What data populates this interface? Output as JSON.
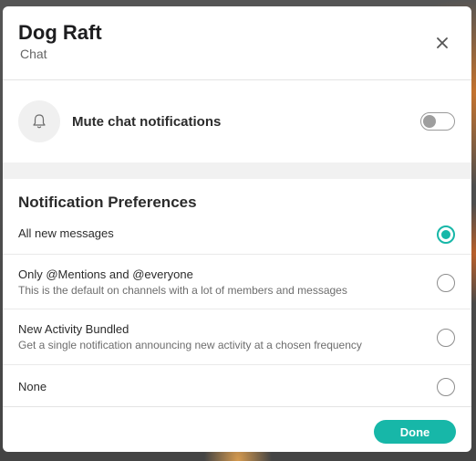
{
  "header": {
    "title": "Dog Raft",
    "subtitle": "Chat",
    "close_icon": "close-icon"
  },
  "mute": {
    "icon": "bell-icon",
    "label": "Mute chat notifications",
    "enabled": false
  },
  "preferences": {
    "title": "Notification Preferences",
    "selected": "all",
    "options": [
      {
        "id": "all",
        "label": "All new messages",
        "description": ""
      },
      {
        "id": "mentions",
        "label": "Only @Mentions and @everyone",
        "description": "This is the default on channels with a lot of members and messages"
      },
      {
        "id": "bundled",
        "label": "New Activity Bundled",
        "description": "Get a single notification announcing new activity at a chosen frequency"
      },
      {
        "id": "none",
        "label": "None",
        "description": ""
      }
    ]
  },
  "footer": {
    "done_label": "Done"
  },
  "colors": {
    "accent": "#17b7a8",
    "toggle_off": "#9e9e9e"
  }
}
